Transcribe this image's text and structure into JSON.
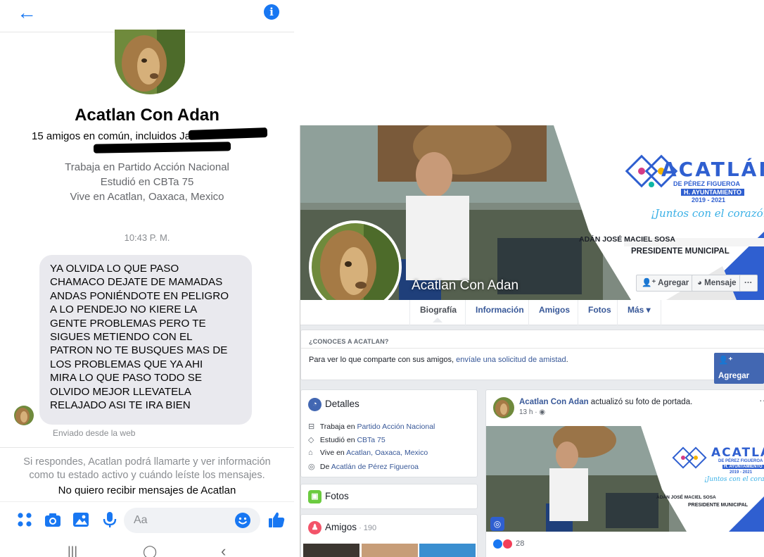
{
  "colors": {
    "messenger_blue": "#1877f2",
    "facebook_blue": "#4267b2",
    "link_blue": "#385898",
    "bubble_gray": "#e9e9ee"
  },
  "messenger": {
    "icons": {
      "back": "back-arrow-icon",
      "info": "info-icon"
    },
    "info_glyph": "i",
    "contact_name": "Acatlan Con Adan",
    "mutual_friends": "15 amigos en común, incluidos Ja",
    "work": "Trabaja en Partido Acción Nacional",
    "education": "Estudió en CBTa 75",
    "lives": "Vive en Acatlan, Oaxaca, Mexico",
    "timestamp": "10:43 P. M.",
    "message_lines": [
      "YA OLVIDA LO QUE PASO",
      "CHAMACO DEJATE DE MAMADAS",
      "ANDAS PONIÉNDOTE EN PELIGRO",
      "A LO PENDEJO NO KIERE LA",
      "GENTE PROBLEMAS PERO TE",
      "SIGUES METIENDO CON EL",
      "PATRON NO TE BUSQUES MAS DE",
      "LOS PROBLEMAS QUE YA AHI",
      "MIRA LO QUE PASO TODO SE",
      "OLVIDO MEJOR LLEVATELA",
      "RELAJADO ASI TE IRA BIEN"
    ],
    "sent_from": "Enviado desde la web",
    "reply_notice_1": "Si respondes, Acatlan podrá llamarte y ver información",
    "reply_notice_2": "como tu estado activo y cuándo leíste los mensajes.",
    "block_option": "No quiero recibir mensajes de Acatlan",
    "composer_placeholder": "Aa",
    "composer_icons": [
      "menu-dots-icon",
      "camera-icon",
      "gallery-icon",
      "microphone-icon",
      "emoji-icon",
      "thumbs-up-icon"
    ],
    "system_nav": {
      "recents": "|||",
      "home": "◯",
      "back": "‹"
    }
  },
  "facebook": {
    "profile_name": "Acatlan Con Adan",
    "cover": {
      "brand": "ACATLÁN",
      "brand_sub": "DE PÉREZ FIGUEROA",
      "ayuntamiento": "H. AYUNTAMIENTO",
      "years": "2019 - 2021",
      "slogan": "¡Juntos con el corazón!",
      "person": "ADÁN JOSÉ MACIEL SOSA",
      "role": "PRESIDENTE MUNICIPAL"
    },
    "buttons": {
      "add": "Agregar",
      "message": "Mensaje",
      "more": "···"
    },
    "tabs": [
      "Biografía",
      "Información",
      "Amigos",
      "Fotos",
      "Más ▾"
    ],
    "know_header": "¿CONOCES A ACATLAN?",
    "know_text": "Para ver lo que comparte con sus amigos,",
    "know_link": "envíale una solicitud de amistad",
    "know_end": ".",
    "know_button": "Agregar",
    "details_title": "Detalles",
    "details": [
      {
        "icon": "briefcase-icon",
        "glyph": "⊟",
        "prefix": "Trabaja en ",
        "link": "Partido Acción Nacional"
      },
      {
        "icon": "graduation-cap-icon",
        "glyph": "◇",
        "prefix": "Estudió en ",
        "link": "CBTa 75"
      },
      {
        "icon": "home-icon",
        "glyph": "⌂",
        "prefix": "Vive en ",
        "link": "Acatlan, Oaxaca, Mexico"
      },
      {
        "icon": "location-pin-icon",
        "glyph": "◎",
        "prefix": "De ",
        "link": "Acatlán de Pérez Figueroa"
      }
    ],
    "photos_title": "Fotos",
    "friends_title": "Amigos",
    "friends_count": " · 190",
    "post": {
      "author": "Acatlan Con Adan",
      "action": " actualizó su foto de portada.",
      "time": "13 h · ",
      "privacy_glyph": "◉",
      "more": "···",
      "reaction_count": "28"
    }
  }
}
